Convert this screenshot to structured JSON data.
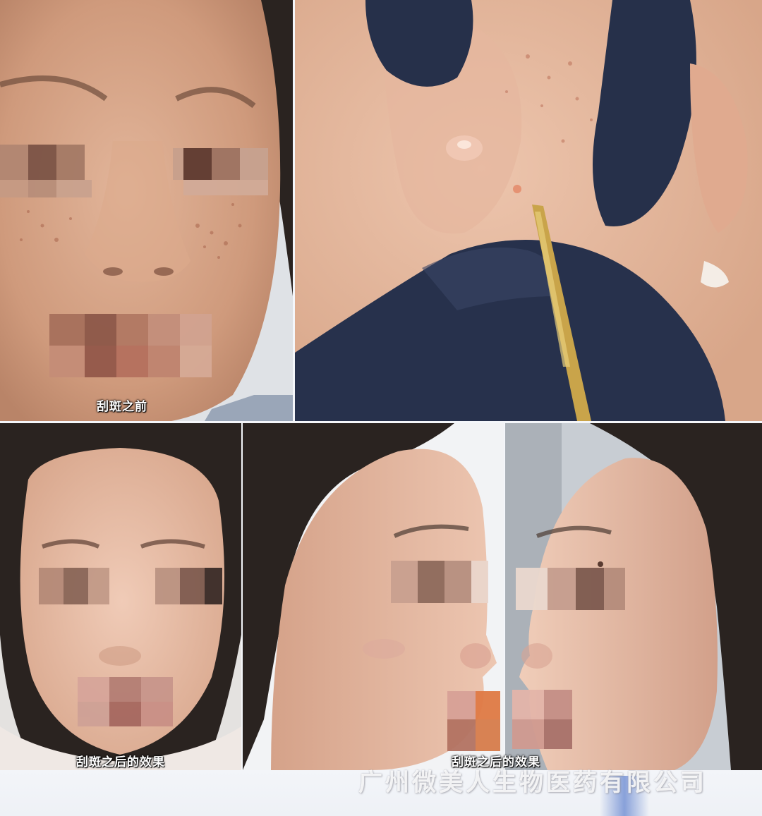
{
  "captions": {
    "before": "刮斑之前",
    "after_front": "刮斑之后的效果",
    "after_side": "刮斑之后的效果"
  },
  "watermark": "广州微美人生物医药有限公司",
  "colors": {
    "skin": "#d9a98d",
    "skin_light": "#e8c5b0",
    "hair": "#2a2320",
    "glove": "#26304a",
    "tool_gold": "#c9a44a",
    "background_wall": "#e9ecef"
  }
}
